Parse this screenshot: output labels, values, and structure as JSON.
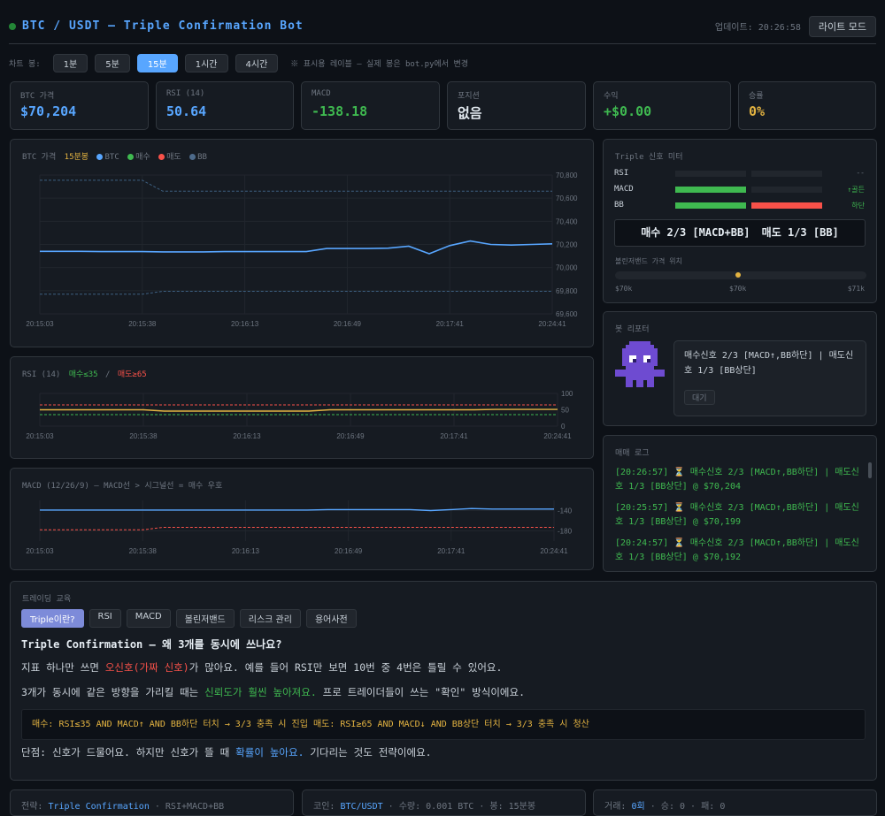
{
  "header": {
    "title": "BTC / USDT — Triple Confirmation Bot",
    "update": "업데이트: 20:26:58",
    "lite_mode": "라이트 모드"
  },
  "timeframe": {
    "label": "차트 봉:",
    "options": [
      "1분",
      "5분",
      "15분",
      "1시간",
      "4시간"
    ],
    "selected": "15분",
    "note": "※ 표시용 레이블 — 실제 봉은 bot.py에서 변경"
  },
  "stats": [
    {
      "label": "BTC 가격",
      "value": "$70,204",
      "color": "#58a6ff"
    },
    {
      "label": "RSI (14)",
      "value": "50.64",
      "color": "#58a6ff"
    },
    {
      "label": "MACD",
      "value": "-138.18",
      "color": "#3fb950"
    },
    {
      "label": "포지션",
      "value": "없음",
      "color": "#e6edf3"
    },
    {
      "label": "수익",
      "value": "+$0.00",
      "color": "#3fb950"
    },
    {
      "label": "승률",
      "value": "0%",
      "color": "#e3b341"
    }
  ],
  "price_chart": {
    "title": "BTC 가격",
    "tf": "15분봉",
    "legend": [
      "BTC",
      "매수",
      "매도",
      "BB"
    ],
    "legend_colors": [
      "#58a6ff",
      "#3fb950",
      "#f85149",
      "#4d6a8a"
    ],
    "y_ticks": [
      "70,800",
      "70,600",
      "70,400",
      "70,200",
      "70,000",
      "69,800",
      "69,600"
    ],
    "x_ticks": [
      "20:15:03",
      "20:15:38",
      "20:16:13",
      "20:16:49",
      "20:17:41",
      "20:24:41"
    ]
  },
  "rsi_chart": {
    "title": "RSI (14)",
    "buy": "매수≤35",
    "sep": "/",
    "sell": "매도≥65",
    "y_ticks": [
      "100",
      "50",
      "0"
    ],
    "x_ticks": [
      "20:15:03",
      "20:15:38",
      "20:16:13",
      "20:16:49",
      "20:17:41",
      "20:24:41"
    ]
  },
  "macd_chart": {
    "title": "MACD (12/26/9) — MACD선 > 시그널선 = 매수 우호",
    "y_ticks": [
      "-140",
      "-180"
    ],
    "x_ticks": [
      "20:15:03",
      "20:15:38",
      "20:16:13",
      "20:16:49",
      "20:17:41",
      "20:24:41"
    ]
  },
  "chart_data": [
    {
      "type": "line",
      "title": "BTC 가격",
      "ylim": [
        69600,
        70800
      ],
      "series": [
        {
          "name": "BTC",
          "values": [
            70140,
            70140,
            70140,
            70138,
            70138,
            70138,
            70136,
            70136,
            70136,
            70138,
            70138,
            70138,
            70138,
            70138,
            70165,
            70165,
            70165,
            70168,
            70185,
            70120,
            70190,
            70230,
            70200,
            70195,
            70200,
            70205
          ]
        },
        {
          "name": "BB",
          "values": [
            70755,
            70755,
            70755,
            70755,
            70755,
            70755,
            70660,
            70660,
            70660,
            70660,
            70660,
            70660,
            70660,
            70660,
            70660,
            70660,
            70660,
            70660,
            70660,
            70660,
            70660,
            70660,
            70660,
            70660,
            70660,
            70660
          ]
        },
        {
          "values": [
            69770,
            69770,
            69770,
            69770,
            69770,
            69770,
            69795,
            69795,
            69795,
            69795,
            69795,
            69795,
            69795,
            69795,
            69795,
            69795,
            69795,
            69795,
            69795,
            69795,
            69795,
            69795,
            69795,
            69795,
            69795,
            69795
          ]
        }
      ]
    },
    {
      "type": "line",
      "title": "RSI (14)",
      "ylim": [
        0,
        100
      ],
      "series": [
        {
          "values": [
            50,
            50,
            50,
            50,
            50,
            50,
            46,
            46,
            46,
            46,
            46,
            46,
            46,
            46,
            50,
            50,
            50,
            50,
            50,
            50,
            50,
            50,
            51,
            51,
            51,
            51
          ]
        }
      ]
    },
    {
      "type": "line",
      "title": "MACD (12/26/9)",
      "ylim": [
        -200,
        -120
      ],
      "series": [
        {
          "values": [
            -139,
            -139,
            -139,
            -139,
            -139,
            -139,
            -139,
            -139,
            -139,
            -139,
            -139,
            -139,
            -139,
            -139,
            -138,
            -138,
            -138,
            -138,
            -138,
            -140,
            -138,
            -136,
            -137,
            -137,
            -137,
            -137
          ]
        },
        {
          "values": [
            -178,
            -178,
            -178,
            -178,
            -178,
            -178,
            -173,
            -173,
            -173,
            -173,
            -173,
            -173,
            -173,
            -173,
            -173,
            -173,
            -173,
            -173,
            -173,
            -173,
            -173,
            -173,
            -173,
            -173,
            -173,
            -173
          ]
        }
      ]
    }
  ],
  "meter": {
    "title": "Triple 신호 미터",
    "rows": [
      {
        "name": "RSI",
        "status": "--",
        "status_color": "#6e7681",
        "buy_fill": 0,
        "sell_fill": 0
      },
      {
        "name": "MACD",
        "status": "↑골든",
        "status_color": "#3fb950",
        "buy_fill": 1,
        "sell_fill": 0
      },
      {
        "name": "BB",
        "status": "하단",
        "status_color": "#3fb950",
        "buy_fill": 1,
        "sell_fill": 1
      }
    ],
    "summary_buy": "매수 2/3 [MACD+BB]",
    "summary_sell": "매도 1/3 [BB]",
    "bb_pos_title": "볼린저밴드 가격 위치",
    "bb_pos": 0.49,
    "bb_labels": [
      "$70k",
      "$70k",
      "$71k"
    ]
  },
  "reporter": {
    "title": "봇 리포터",
    "message": "매수신호 2/3 [MACD↑,BB하단] | 매도신호 1/3 [BB상단]",
    "status": "대기"
  },
  "log": {
    "title": "매매 로그",
    "entries": [
      "[20:26:57] ⏳ 매수신호 2/3 [MACD↑,BB하단] | 매도신호 1/3 [BB상단] @ $70,204",
      "[20:25:57] ⏳ 매수신호 2/3 [MACD↑,BB하단] | 매도신호 1/3 [BB상단] @ $70,199",
      "[20:24:57] ⏳ 매수신호 2/3 [MACD↑,BB하단] | 매도신호 1/3 [BB상단] @ $70,192"
    ]
  },
  "edu": {
    "title": "트레이딩 교육",
    "tabs": [
      "Triple이란?",
      "RSI",
      "MACD",
      "볼린저밴드",
      "리스크 관리",
      "용어사전"
    ],
    "heading": "Triple Confirmation — 왜 3개를 동시에 쓰나요?",
    "p1a": "지표 하나만 쓰면 ",
    "p1b": "오신호(가짜 신호)",
    "p1c": "가 많아요. 예를 들어 RSI만 보면 10번 중 4번은 틀릴 수 있어요.",
    "p2a": "3개가 동시에 같은 방향을 가리킬 때는 ",
    "p2b": "신뢰도가 훨씬 높아져요.",
    "p2c": " 프로 트레이더들이 쓰는 \"확인\" 방식이에요.",
    "rule": "매수: RSI≤35 AND MACD↑ AND BB하단 터치 → 3/3 충족 시 진입 매도: RSI≥65 AND MACD↓ AND BB상단 터치 → 3/3 충족 시 청산",
    "p3a": "단점: 신호가 드물어요. 하지만 신호가 뜰 때 ",
    "p3b": "확률이 높아요.",
    "p3c": " 기다리는 것도 전략이에요."
  },
  "footer": [
    {
      "label": "전략:",
      "value": "Triple Confirmation",
      "extra": "· RSI+MACD+BB"
    },
    {
      "label": "코인:",
      "value": "BTC/USDT",
      "extra": "· 수량: 0.001 BTC · 봉: 15분봉"
    },
    {
      "label": "거래:",
      "value": "0회",
      "extra": "· 승: 0 · 패: 0"
    }
  ]
}
